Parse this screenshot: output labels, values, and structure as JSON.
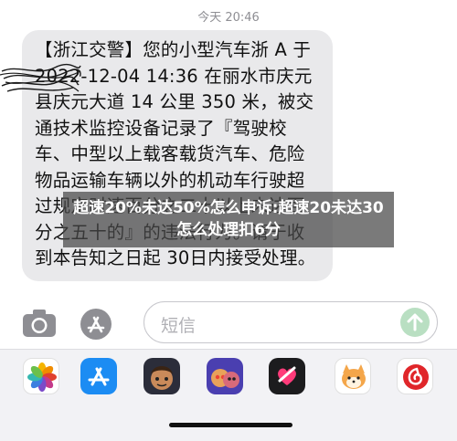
{
  "timestamp": "今天 20:46",
  "message": {
    "text": "【浙江交警】您的小型汽车浙 A 于 2022-12-04 14:36 在丽水市庆元县庆元大道 14 公里 350 米，被交通技术监控设备记录了『驾驶校车、中型以上载客载货汽车、危险物品运输车辆以外的机动车行驶超过规定时速百分之二十以上未达百分之五十的』的违法行为。请于收到本告知之日起 30日内接受处理。"
  },
  "overlay": {
    "text": "超速20%未达50%怎么申诉:超速20未达30怎么处理扣6分"
  },
  "input": {
    "placeholder": "短信"
  },
  "app_strip": {
    "apps": [
      {
        "icon": "photos-icon"
      },
      {
        "icon": "app-store-icon"
      },
      {
        "icon": "memoji-icon"
      },
      {
        "icon": "animoji-icon"
      },
      {
        "icon": "digital-touch-icon"
      },
      {
        "icon": "sticker-dog-icon"
      },
      {
        "icon": "netease-music-icon"
      }
    ]
  },
  "colors": {
    "bubble": "#e9e9eb",
    "send": "#b9dfc2",
    "appstore": "#1c8cf3",
    "netease": "#e0262a"
  }
}
